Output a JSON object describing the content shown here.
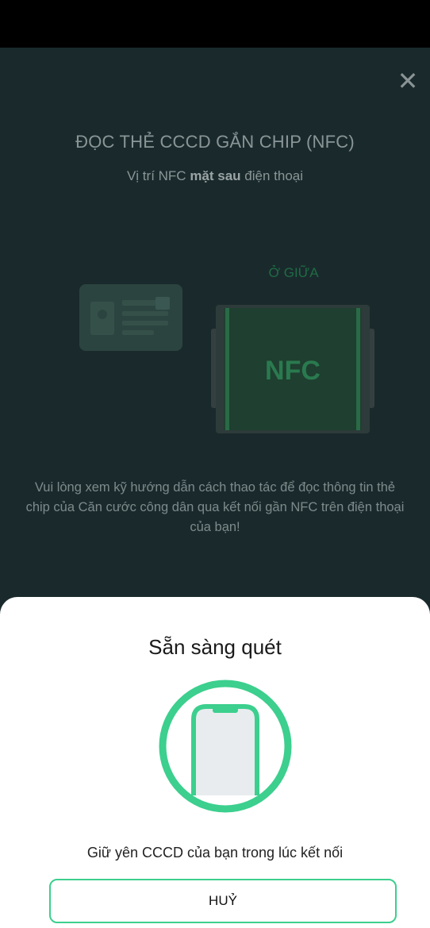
{
  "header": {
    "close_symbol": "✕"
  },
  "main": {
    "title": "ĐỌC THẺ CCCD GẮN CHIP (NFC)",
    "subtitle_prefix": "Vị trí NFC ",
    "subtitle_bold": "mặt sau",
    "subtitle_suffix": " điện thoại",
    "position_label": "Ở GIỮA",
    "nfc_label": "NFC",
    "instructions": "Vui lòng xem kỹ hướng dẫn cách thao tác để đọc thông tin thẻ chip của Căn cước công dân qua kết nối gần NFC trên điện thoại của bạn!"
  },
  "sheet": {
    "title": "Sẵn sàng quét",
    "hold_text": "Giữ yên CCCD của bạn trong lúc kết nối",
    "cancel_label": "HUỶ"
  },
  "colors": {
    "accent": "#3ccf8e",
    "overlay_bg": "#1a2a2c"
  },
  "icons": [
    "close-icon",
    "id-card-icon",
    "phone-nfc-icon",
    "scan-phone-icon"
  ]
}
